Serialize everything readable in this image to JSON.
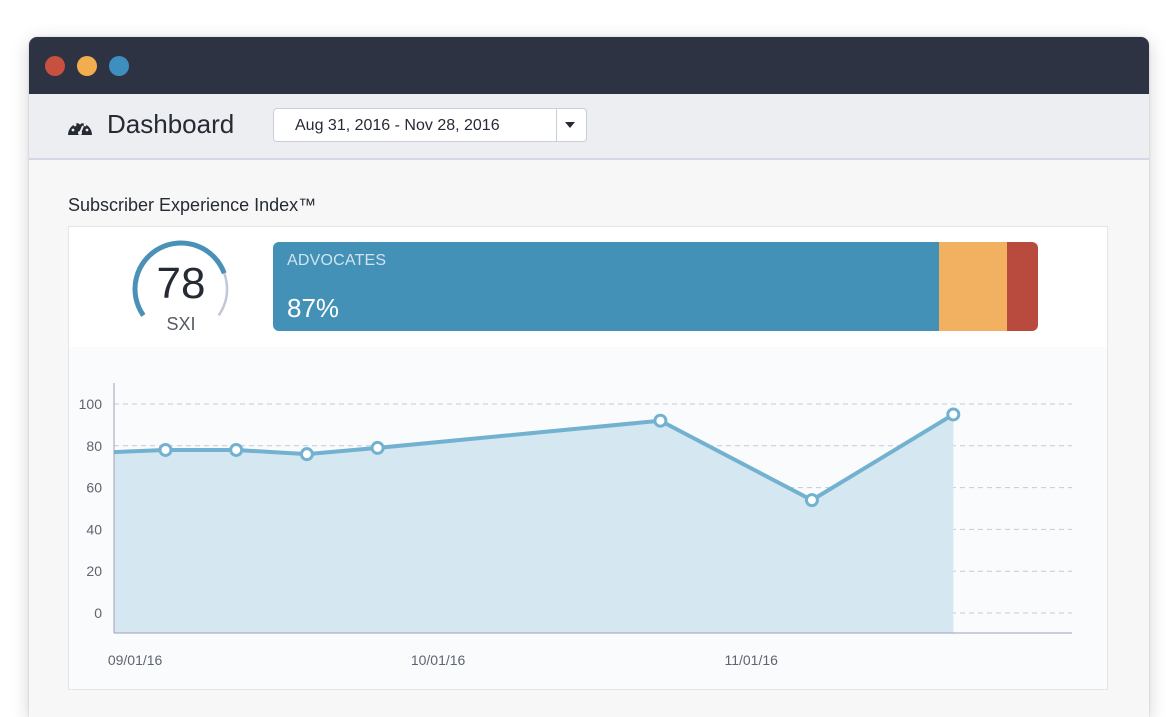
{
  "window": {
    "traffic_lights": [
      {
        "name": "close",
        "color": "#c8503f"
      },
      {
        "name": "minimize",
        "color": "#f2ad4f"
      },
      {
        "name": "zoom",
        "color": "#3d8fbf"
      }
    ]
  },
  "header": {
    "icon": "dashboard-gauge-icon",
    "title": "Dashboard",
    "date_range": {
      "value": "Aug 31, 2016 - Nov 28, 2016",
      "toggle_icon": "caret-down-icon"
    }
  },
  "sxi": {
    "section_title": "Subscriber Experience Index™",
    "score": "78",
    "score_label": "SXI",
    "score_value": 78,
    "score_max": 100,
    "gauge_colors": {
      "active": "#4a91b8",
      "track": "#c2c7d6"
    },
    "breakdown": [
      {
        "name": "advocates",
        "label": "ADVOCATES",
        "percent_text": "87%",
        "percent": 87,
        "color": "#4391b7"
      },
      {
        "name": "neutral",
        "label": "",
        "percent_text": "",
        "percent": 9,
        "color": "#f2b160"
      },
      {
        "name": "detractors",
        "label": "",
        "percent_text": "",
        "percent": 4,
        "color": "#b84a3e"
      }
    ]
  },
  "chart_data": {
    "type": "area",
    "title": "",
    "xlabel": "",
    "ylabel": "",
    "ylim": [
      0,
      100
    ],
    "yticks": [
      0,
      20,
      40,
      60,
      80,
      100
    ],
    "x_ticks": [
      {
        "date": "2016-09-01",
        "label": "09/01/16"
      },
      {
        "date": "2016-10-01",
        "label": "10/01/16"
      },
      {
        "date": "2016-11-01",
        "label": "11/01/16"
      }
    ],
    "x_range": [
      "2016-08-31",
      "2016-11-28"
    ],
    "grid": true,
    "line_color": "#72b1d0",
    "fill_color": "#d5e7f0",
    "series": [
      {
        "points": [
          {
            "x": "2016-08-29",
            "y": 77
          },
          {
            "x": "2016-09-05",
            "y": 78
          },
          {
            "x": "2016-09-12",
            "y": 78
          },
          {
            "x": "2016-09-19",
            "y": 76
          },
          {
            "x": "2016-09-26",
            "y": 79
          },
          {
            "x": "2016-10-24",
            "y": 92
          },
          {
            "x": "2016-11-08",
            "y": 54
          },
          {
            "x": "2016-11-22",
            "y": 95
          }
        ],
        "first_point_marker": false
      }
    ]
  }
}
